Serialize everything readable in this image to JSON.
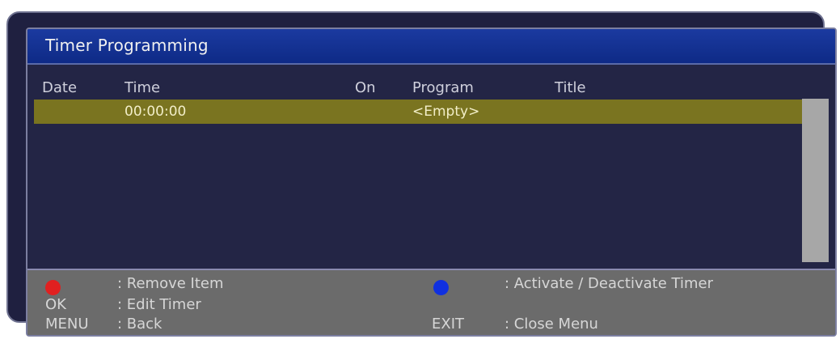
{
  "window": {
    "title": "Timer Programming"
  },
  "columns": {
    "date": "Date",
    "time": "Time",
    "on": "On",
    "program": "Program",
    "title": "Title"
  },
  "rows": [
    {
      "date": "",
      "time": "00:00:00",
      "on": "",
      "program": "<Empty>",
      "title": ""
    }
  ],
  "footer": {
    "remove_key_icon": "red-circle",
    "remove_label": ": Remove Item",
    "activate_key_icon": "blue-circle",
    "activate_label": ": Activate / Deactivate Timer",
    "ok_key": "OK",
    "ok_label": ": Edit Timer",
    "menu_key": "MENU",
    "menu_label": ": Back",
    "exit_key": "EXIT",
    "exit_label": ": Close Menu"
  },
  "colors": {
    "title_bar": "#0e2a86",
    "selected_row": "#7a7420",
    "red_button": "#e02020",
    "blue_button": "#1030e0"
  }
}
